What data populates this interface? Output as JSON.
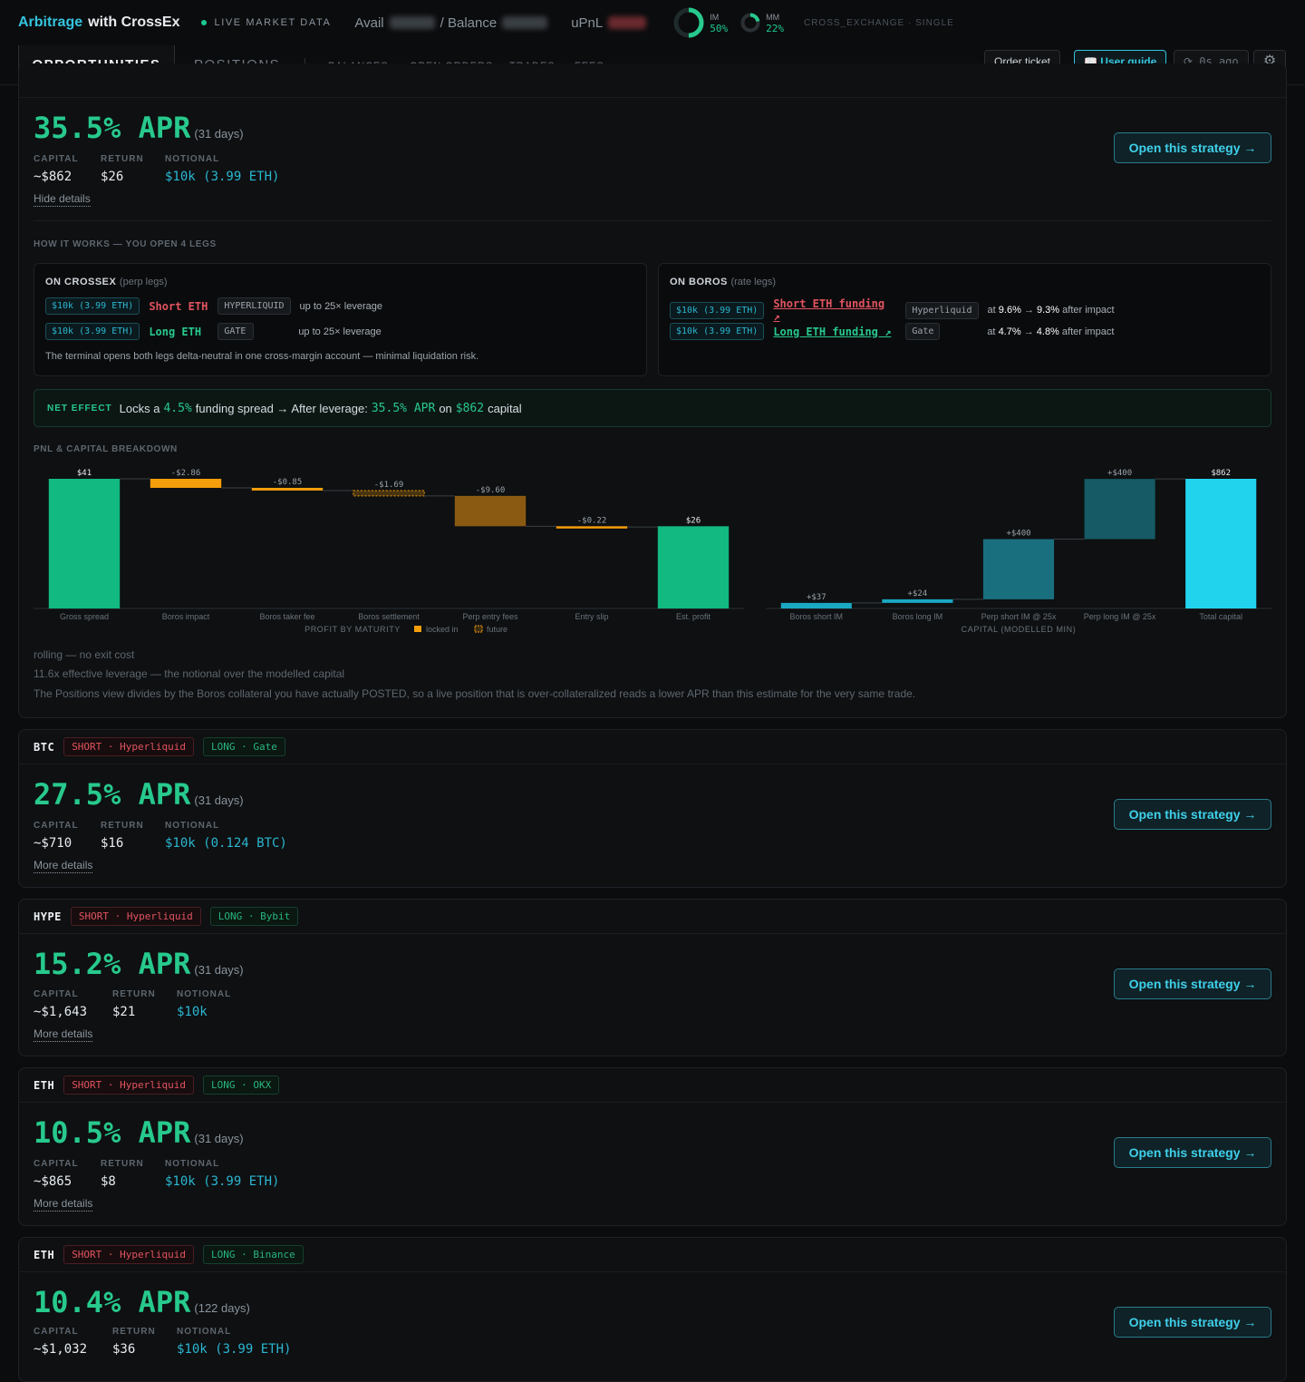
{
  "header": {
    "brand_accent": "Arbitrage",
    "brand_rest": "with CrossEx",
    "live_label": "LIVE MARKET DATA",
    "avail_label": "Avail",
    "balance_label": "/ Balance",
    "upnl_label": "uPnL",
    "im_label": "IM",
    "im_value": "50%",
    "im_fraction": 0.5,
    "mm_label": "MM",
    "mm_value": "22%",
    "mm_fraction": 0.22,
    "mode": "CROSS_EXCHANGE · SINGLE"
  },
  "nav": {
    "tab_opportunities": "OPPORTUNITIES",
    "tab_positions": "POSITIONS",
    "sub_balances": "BALANCES",
    "sub_open_orders": "OPEN ORDERS",
    "sub_trades": "TRADES",
    "sub_fees": "FEES",
    "order_ticket": "Order ticket",
    "user_guide": "📖 User guide",
    "refresh": "⟳ 0s ago",
    "settings_icon": "⚙"
  },
  "expanded": {
    "apr": "35.5% APR",
    "days": "(31 days)",
    "capital_label": "CAPITAL",
    "capital": "~$862",
    "return_label": "RETURN",
    "return": "$26",
    "notional_label": "NOTIONAL",
    "notional": "$10k (3.99 ETH)",
    "details_link": "Hide details",
    "open_button": "Open this strategy →",
    "how_title": "HOW IT WORKS — YOU OPEN 4 LEGS",
    "crossex": {
      "title": "ON CROSSEX",
      "subtitle": "(perp legs)",
      "legs": [
        {
          "size": "$10k (3.99 ETH)",
          "side": "Short ETH",
          "venue": "HYPERLIQUID",
          "lev": "up to 25× leverage"
        },
        {
          "size": "$10k (3.99 ETH)",
          "side": "Long ETH",
          "venue": "GATE",
          "lev": "up to 25× leverage"
        }
      ],
      "note": "The terminal opens both legs delta-neutral in one cross-margin account — minimal liquidation risk."
    },
    "boros": {
      "title": "ON BOROS",
      "subtitle": "(rate legs)",
      "legs": [
        {
          "size": "$10k (3.99 ETH)",
          "side": "Short ETH funding ↗",
          "venue": "Hyperliquid",
          "at": "at",
          "from": "9.6%",
          "arrow": "→",
          "to": "9.3%",
          "after": "after impact"
        },
        {
          "size": "$10k (3.99 ETH)",
          "side": "Long ETH funding ↗",
          "venue": "Gate",
          "at": "at",
          "from": "4.7%",
          "arrow": "→",
          "to": "4.8%",
          "after": "after impact"
        }
      ]
    },
    "net": {
      "tag": "NET EFFECT",
      "t1": "Locks a",
      "spread": "4.5%",
      "t2": "funding spread → After leverage:",
      "apr": "35.5% APR",
      "t3": "on",
      "capital": "$862",
      "t4": "capital"
    },
    "pnl_title": "PNL & CAPITAL BREAKDOWN",
    "footnotes": [
      "rolling — no exit cost",
      "11.6x effective leverage — the notional over the modelled capital",
      "The Positions view divides by the Boros collateral you have actually POSTED, so a live position that is over-collateralized reads a lower APR than this estimate for the very same trade."
    ]
  },
  "chart_data": [
    {
      "type": "bar",
      "subtype": "waterfall",
      "title": "PROFIT BY MATURITY",
      "legend": [
        "locked in",
        "future"
      ],
      "categories": [
        "Gross spread",
        "Boros impact",
        "Boros taker fee",
        "Boros settlement",
        "Perp entry fees",
        "Entry slip",
        "Est. profit"
      ],
      "values": [
        41,
        -2.86,
        -0.85,
        -1.69,
        -9.6,
        -0.22,
        26
      ],
      "labels": [
        "$41",
        "-$2.86",
        "-$0.85",
        "-$1.69",
        "-$9.60",
        "-$0.22",
        "$26"
      ],
      "kinds": [
        "total",
        "locked",
        "locked",
        "future",
        "locked",
        "locked",
        "total"
      ],
      "colors": {
        "total": "#12b981",
        "locked": "#f59e0b",
        "future": "#f59e0b"
      },
      "ylim": [
        0,
        41
      ]
    },
    {
      "type": "bar",
      "subtype": "waterfall",
      "title": "CAPITAL (MODELLED MIN)",
      "categories": [
        "Boros short IM",
        "Boros long IM",
        "Perp short IM @ 25x",
        "Perp long IM @ 25x",
        "Total capital"
      ],
      "values": [
        37,
        24,
        400,
        400,
        862
      ],
      "labels": [
        "+$37",
        "+$24",
        "+$400",
        "+$400",
        "$862"
      ],
      "kinds": [
        "step",
        "step",
        "step",
        "step",
        "total"
      ],
      "colors": {
        "step": "#1aa8c4",
        "total": "#22d3ee"
      },
      "ylim": [
        0,
        862
      ]
    }
  ],
  "cards": [
    {
      "asset": "BTC",
      "short": "SHORT · Hyperliquid",
      "long": "LONG · Gate",
      "apr": "27.5% APR",
      "days": "(31 days)",
      "capital_label": "CAPITAL",
      "capital": "~$710",
      "return_label": "RETURN",
      "return": "$16",
      "notional_label": "NOTIONAL",
      "notional": "$10k (0.124 BTC)",
      "details": "More details",
      "button": "Open this strategy →"
    },
    {
      "asset": "HYPE",
      "short": "SHORT · Hyperliquid",
      "long": "LONG · Bybit",
      "apr": "15.2% APR",
      "days": "(31 days)",
      "capital_label": "CAPITAL",
      "capital": "~$1,643",
      "return_label": "RETURN",
      "return": "$21",
      "notional_label": "NOTIONAL",
      "notional": "$10k",
      "details": "More details",
      "button": "Open this strategy →"
    },
    {
      "asset": "ETH",
      "short": "SHORT · Hyperliquid",
      "long": "LONG · OKX",
      "apr": "10.5% APR",
      "days": "(31 days)",
      "capital_label": "CAPITAL",
      "capital": "~$865",
      "return_label": "RETURN",
      "return": "$8",
      "notional_label": "NOTIONAL",
      "notional": "$10k (3.99 ETH)",
      "details": "More details",
      "button": "Open this strategy →"
    },
    {
      "asset": "ETH",
      "short": "SHORT · Hyperliquid",
      "long": "LONG · Binance",
      "apr": "10.4% APR",
      "days": "(122 days)",
      "capital_label": "CAPITAL",
      "capital": "~$1,032",
      "return_label": "RETURN",
      "return": "$36",
      "notional_label": "NOTIONAL",
      "notional": "$10k (3.99 ETH)",
      "details": "More details",
      "button": "Open this strategy →"
    }
  ]
}
